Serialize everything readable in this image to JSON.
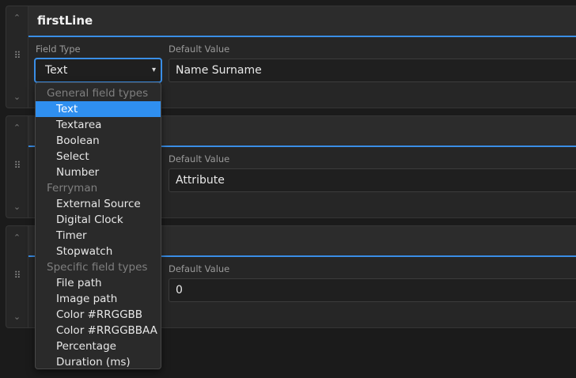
{
  "panels": [
    {
      "title": "firstLine",
      "field_type_label": "Field Type",
      "default_value_label": "Default Value",
      "default_value": "Name Surname"
    },
    {
      "title": "",
      "field_type_label": "",
      "default_value_label": "Default Value",
      "default_value": "Attribute"
    },
    {
      "title": "",
      "field_type_label": "",
      "default_value_label": "Default Value",
      "default_value": "0"
    }
  ],
  "select": {
    "value": "Text",
    "chevron": "▾"
  },
  "dropdown": {
    "group1": "General field types",
    "group1_items": [
      "Text",
      "Textarea",
      "Boolean",
      "Select",
      "Number"
    ],
    "group2": "Ferryman",
    "group2_items": [
      "External Source",
      "Digital Clock",
      "Timer",
      "Stopwatch"
    ],
    "group3": "Specific field types",
    "group3_items": [
      "File path",
      "Image path",
      "Color #RRGGBB",
      "Color #RRGGBBAA",
      "Percentage",
      "Duration (ms)"
    ],
    "selected": "Text"
  },
  "icons": {
    "up": "⌃",
    "down": "⌄",
    "grip": "⠿"
  },
  "colors": {
    "accent": "#3a8ee6",
    "selected_bg": "#2f8ff0"
  }
}
